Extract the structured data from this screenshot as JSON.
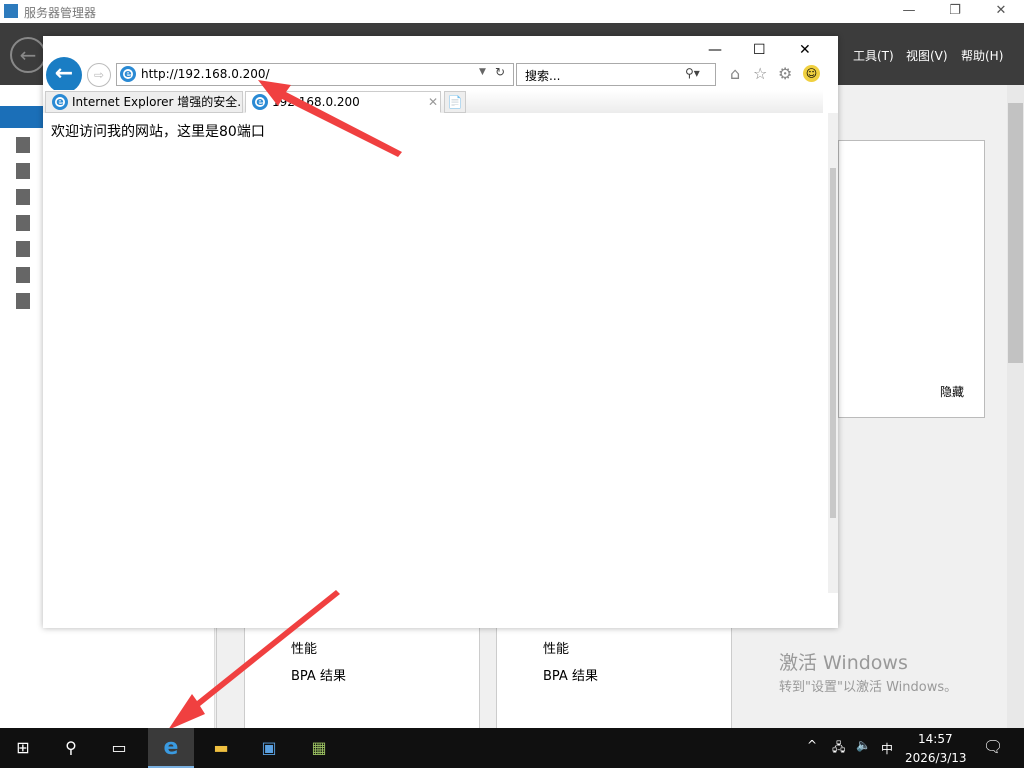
{
  "server_manager": {
    "title": "服务器管理器",
    "menu": [
      "工具(T)",
      "视图(V)",
      "帮助(H)"
    ],
    "panel_hide": "隐藏",
    "tiles": [
      {
        "perf": "性能",
        "bpa": "BPA 结果"
      },
      {
        "perf": "性能",
        "bpa": "BPA 结果"
      }
    ]
  },
  "ie": {
    "address": "http://192.168.0.200/",
    "search_placeholder": "搜索...",
    "tabs": [
      {
        "label": "Internet Explorer 增强的安全..."
      },
      {
        "label": "192.168.0.200"
      }
    ],
    "page_text": "欢迎访问我的网站，这里是80端口"
  },
  "watermark": {
    "line1": "激活 Windows",
    "line2": "转到\"设置\"以激活 Windows。"
  },
  "taskbar": {
    "time": "14:57",
    "date": "2026/3/13",
    "ime": "中"
  },
  "colors": {
    "arrow": "#f04040",
    "ie_blue": "#1a7dc4"
  }
}
